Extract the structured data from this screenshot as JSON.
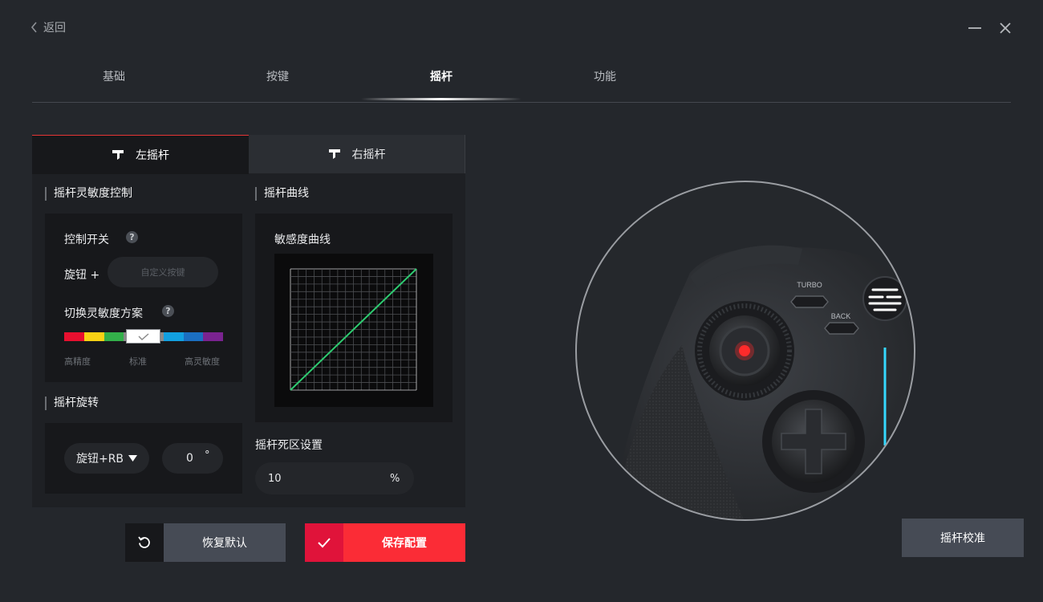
{
  "topbar": {
    "back_label": "返回"
  },
  "tabs": [
    {
      "label": "基础"
    },
    {
      "label": "按键"
    },
    {
      "label": "摇杆",
      "active": true
    },
    {
      "label": "功能"
    }
  ],
  "stick_tabs": {
    "left": "左摇杆",
    "right": "右摇杆"
  },
  "sensitivity": {
    "title": "摇杆灵敏度控制",
    "control_switch_label": "控制开关",
    "knob_label": "旋钮 +",
    "custom_key_placeholder": "自定义按键",
    "switch_scheme_label": "切换灵敏度方案",
    "scale": {
      "low": "高精度",
      "mid": "标准",
      "high": "高灵敏度"
    },
    "bar_colors": [
      "#e8102f",
      "#f8d214",
      "#33b04a",
      "#8a8a8a",
      "#8a8a8a",
      "#12a0e0",
      "#1b6fc1",
      "#7a2390"
    ],
    "selected_level": "标准"
  },
  "rotation": {
    "title": "摇杆旋转",
    "mode_value": "旋钮+RB",
    "angle_value": "0",
    "angle_unit": "°"
  },
  "curve": {
    "section_title": "摇杆曲线",
    "chart_title": "敏感度曲线",
    "line_color": "#2ecc71"
  },
  "deadzone": {
    "title": "摇杆死区设置",
    "value": "10",
    "unit": "%"
  },
  "buttons": {
    "reset": "恢复默认",
    "save": "保存配置",
    "calibrate": "摇杆校准"
  },
  "controller": {
    "turbo_label": "TURBO",
    "back_label": "BACK",
    "led_color": "#35d9ff",
    "stick_dot_color": "#ff2b2b"
  }
}
